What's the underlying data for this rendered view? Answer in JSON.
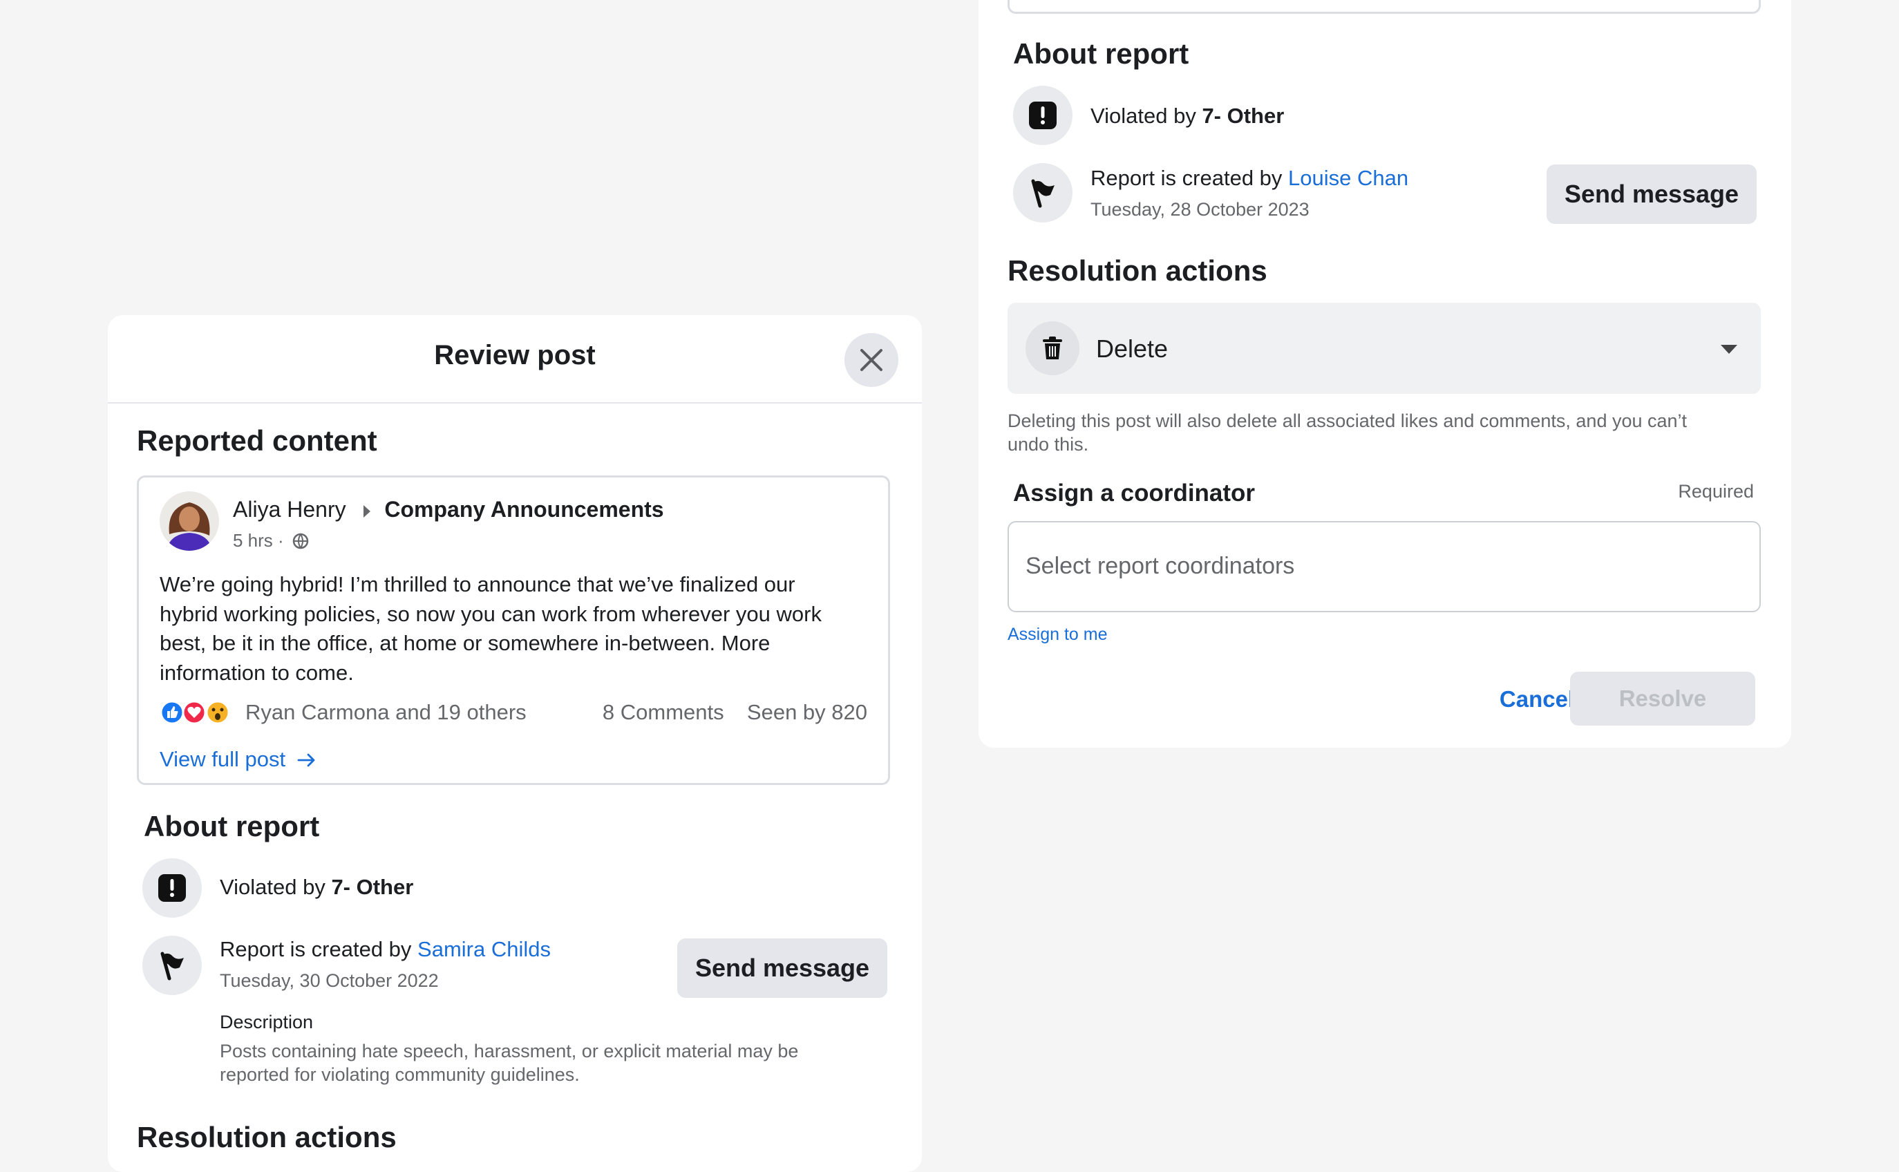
{
  "left_panel": {
    "title": "Review post",
    "reported_content_heading": "Reported content",
    "post": {
      "author": "Aliya Henry",
      "group": "Company Announcements",
      "time": "5 hrs ·",
      "text_lines": [
        "We’re going hybrid! I’m thrilled to announce that we’ve finalized our",
        "hybrid working policies, so now you can work from wherever you work",
        "best, be it in the office, at home or somewhere in-between. More",
        "information to come."
      ],
      "reactions_text": "Ryan Carmona and 19 others",
      "comments": "8 Comments",
      "seen_by": "Seen by 820",
      "view_full_post": "View full post"
    },
    "about_report_heading": "About report",
    "violated_prefix": "Violated by ",
    "violated_value": "7- Other",
    "created_prefix": "Report is created by ",
    "created_by": "Samira Childs",
    "created_date": "Tuesday, 30 October 2022",
    "send_message": "Send message",
    "description_label": "Description",
    "description_lines": [
      "Posts containing hate speech, harassment, or explicit material may be",
      "reported for violating community guidelines."
    ],
    "resolution_heading": "Resolution actions"
  },
  "right_panel": {
    "about_report_heading": "About report",
    "violated_prefix": "Violated by ",
    "violated_value": "7- Other",
    "created_prefix": "Report is created by ",
    "created_by": "Louise Chan",
    "created_date": "Tuesday, 28 October 2023",
    "send_message": "Send message",
    "resolution_heading": "Resolution actions",
    "action_selected": "Delete",
    "delete_warning_lines": [
      "Deleting this post will also delete all associated likes and comments, and you can’t",
      "undo this."
    ],
    "assign_label": "Assign a coordinator",
    "required_label": "Required",
    "coordinator_placeholder": "Select report coordinators",
    "assign_to_me": "Assign to me",
    "cancel": "Cancel",
    "resolve": "Resolve"
  },
  "colors": {
    "background": "#f5f5f6",
    "link": "#1a6ed8",
    "button_grey": "#e4e6eb",
    "disabled_text": "#bcc0c4"
  },
  "icons": [
    "close-icon",
    "alert-icon",
    "flag-icon",
    "trash-icon",
    "caret-down-icon",
    "globe-icon",
    "like-icon",
    "love-icon",
    "wow-icon",
    "arrow-right-icon"
  ]
}
